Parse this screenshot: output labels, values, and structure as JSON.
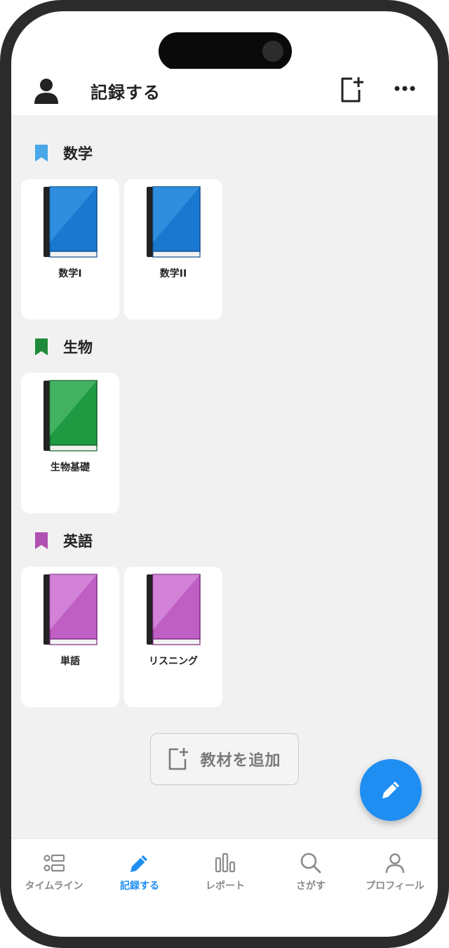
{
  "header": {
    "title": "記録する",
    "avatar_icon": "person-icon",
    "add_icon": "add-document-icon",
    "more_icon": "more-dots-icon"
  },
  "sections": [
    {
      "title": "数学",
      "color": "#4aa8e8",
      "items": [
        {
          "label": "数学I"
        },
        {
          "label": "数学II"
        }
      ]
    },
    {
      "title": "生物",
      "color": "#1f8a3b",
      "items": [
        {
          "label": "生物基礎"
        }
      ]
    },
    {
      "title": "英語",
      "color": "#b050b0",
      "items": [
        {
          "label": "単語"
        },
        {
          "label": "リスニング"
        }
      ]
    }
  ],
  "add_material": {
    "label": "教材を追加",
    "icon": "add-document-icon"
  },
  "fab": {
    "icon": "pencil-icon",
    "color": "#1e8ef2"
  },
  "tabs": [
    {
      "label": "タイムライン",
      "icon": "timeline-icon",
      "active": false
    },
    {
      "label": "記録する",
      "icon": "pencil-icon",
      "active": true
    },
    {
      "label": "レポート",
      "icon": "bar-chart-icon",
      "active": false
    },
    {
      "label": "さがす",
      "icon": "search-icon",
      "active": false
    },
    {
      "label": "プロフィール",
      "icon": "profile-icon",
      "active": false
    }
  ]
}
